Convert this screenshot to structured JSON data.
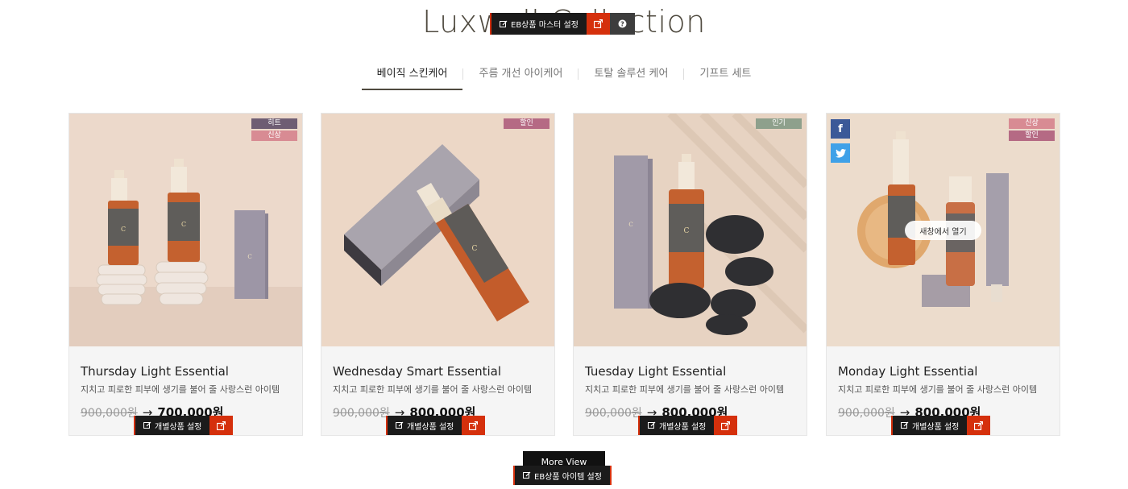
{
  "header": {
    "title": "Luxwell Collection"
  },
  "eb_master": {
    "label": "EB상품 마스터 설정",
    "link_icon": "external-link-icon",
    "help_icon": "question-icon"
  },
  "tabs": [
    {
      "label": "베이직 스킨케어"
    },
    {
      "label": "주름 개선 아이케어"
    },
    {
      "label": "토탈 솔루션 케어"
    },
    {
      "label": "기프트 세트"
    }
  ],
  "products": [
    {
      "name": "Thursday Light Essential",
      "desc": "지치고 피로한 피부에 생기를 불어 줄 사랑스런 아이템",
      "orig_price": "900,000원",
      "sale_price": "700,000원",
      "badges": [
        "히트",
        "신상"
      ],
      "edit_label": "개별상품 설정"
    },
    {
      "name": "Wednesday Smart Essential",
      "desc": "지치고 피로한 피부에 생기를 불어 줄 사랑스런 아이템",
      "orig_price": "900,000원",
      "sale_price": "800,000원",
      "badges": [
        "할인"
      ],
      "edit_label": "개별상품 설정"
    },
    {
      "name": "Tuesday Light Essential",
      "desc": "지치고 피로한 피부에 생기를 불어 줄 사랑스런 아이템",
      "orig_price": "900,000원",
      "sale_price": "800,000원",
      "badges": [
        "인기"
      ],
      "edit_label": "개별상품 설정"
    },
    {
      "name": "Monday Light Essential",
      "desc": "지치고 피로한 피부에 생기를 불어 줄 사랑스런 아이템",
      "orig_price": "900,000원",
      "sale_price": "800,000원",
      "badges": [
        "신상",
        "할인"
      ],
      "edit_label": "개별상품 설정",
      "open_new_label": "새창에서 열기",
      "social": [
        "f",
        "twitter-icon"
      ]
    }
  ],
  "footer": {
    "more_label": "More View",
    "eb_items_label": "EB상품 아이템 설정"
  },
  "colors": {
    "accent_red": "#d5300c",
    "title_color": "#4f4a3f",
    "badge_hit": "#6e5d73",
    "badge_new": "#d88b93",
    "badge_sale": "#b56a84",
    "badge_popular": "#8ea08c"
  }
}
